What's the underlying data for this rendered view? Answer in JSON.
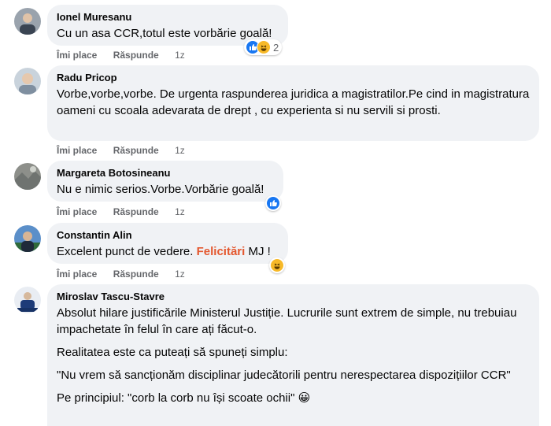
{
  "actions": {
    "like": "Îmi place",
    "reply": "Răspunde"
  },
  "comments": [
    {
      "author": "Ionel Muresanu",
      "text": "Cu un asa CCR,totul este vorbărie goală!",
      "time": "1z",
      "reaction_count": "2",
      "reactions": [
        "like",
        "haha"
      ]
    },
    {
      "author": "Radu Pricop",
      "text": "Vorbe,vorbe,vorbe. De urgenta raspunderea juridica a magistratilor.Pe cind in magistratura oameni cu scoala adevarata de drept , cu experienta si nu servili si prosti.",
      "time": "1z"
    },
    {
      "author": "Margareta Botosineanu",
      "text": "Nu e nimic serios.Vorbe.Vorbărie goală!",
      "time": "1z",
      "reactions": [
        "like"
      ]
    },
    {
      "author": "Constantin Alin",
      "text_before": "Excelent punct de vedere. ",
      "text_highlight": "Felicitări",
      "text_after": " MJ !",
      "time": "1z",
      "reactions": [
        "haha"
      ]
    },
    {
      "author": "Miroslav Tascu-Stavre",
      "paragraphs": [
        "Absolut hilare justificările Ministerul Justiție. Lucrurile sunt extrem de simple, nu trebuiau impachetate în felul în care ați făcut-o.",
        "Realitatea este ca puteați să spuneți simplu:",
        "\"Nu vrem să sancționăm disciplinar judecătorili pentru nerespectarea dispozițiilor CCR\"",
        "Pe principiul: \"corb la corb nu își scoate ochii\" 😀"
      ]
    }
  ],
  "colors": {
    "bubble": "#f0f2f5",
    "meta_text": "#65676b",
    "like": "#1877f2",
    "haha": "#f7b928",
    "highlight": "#e4572e"
  }
}
